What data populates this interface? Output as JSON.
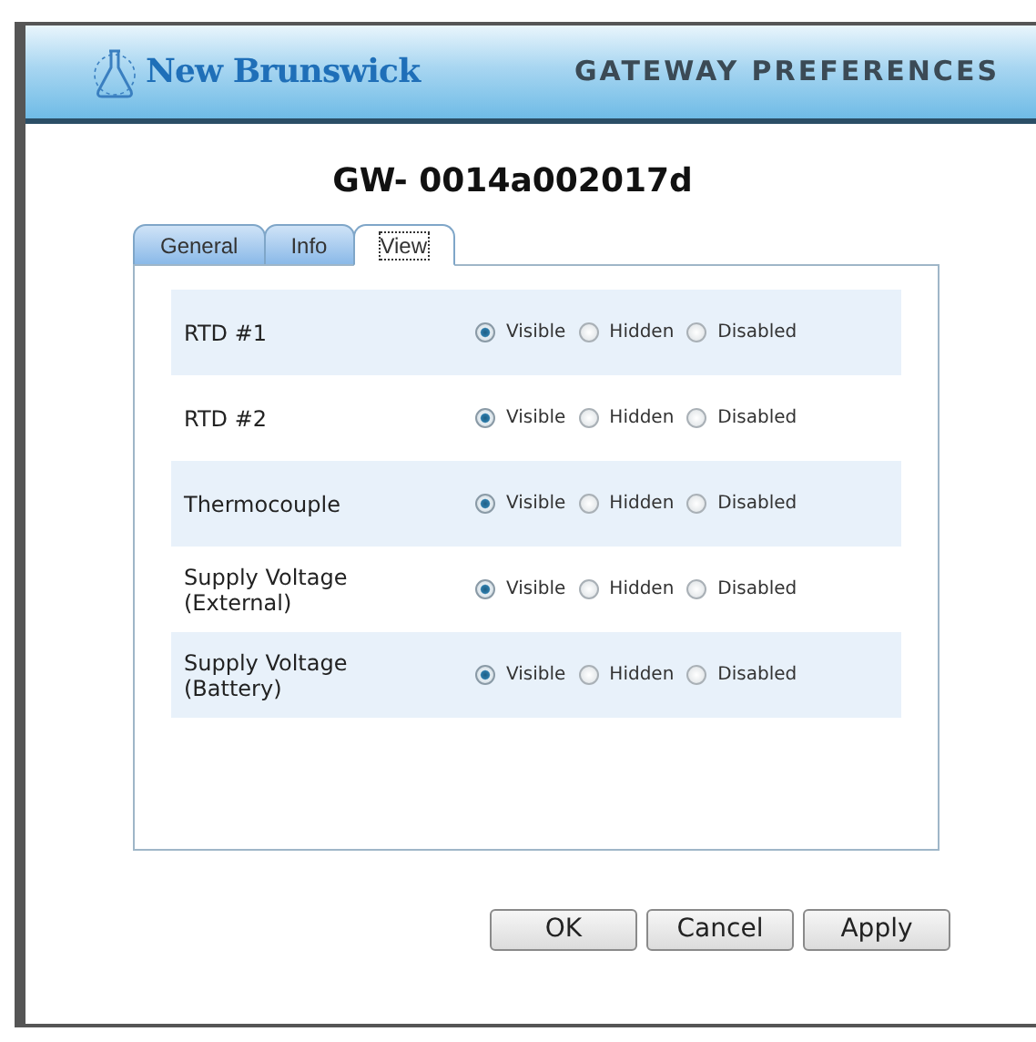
{
  "header": {
    "brand": "New Brunswick",
    "title": "GATEWAY PREFERENCES"
  },
  "device_title": "GW- 0014a002017d",
  "tabs": [
    {
      "label": "General",
      "selected": false
    },
    {
      "label": "Info",
      "selected": false
    },
    {
      "label": "View",
      "selected": true
    }
  ],
  "rows": [
    {
      "label": "RTD #1",
      "options": [
        {
          "label": "Visible",
          "selected": true
        },
        {
          "label": "Hidden",
          "selected": false
        },
        {
          "label": "Disabled",
          "selected": false
        }
      ]
    },
    {
      "label": "RTD #2",
      "options": [
        {
          "label": "Visible",
          "selected": true
        },
        {
          "label": "Hidden",
          "selected": false
        },
        {
          "label": "Disabled",
          "selected": false
        }
      ]
    },
    {
      "label": "Thermocouple",
      "options": [
        {
          "label": "Visible",
          "selected": true
        },
        {
          "label": "Hidden",
          "selected": false
        },
        {
          "label": "Disabled",
          "selected": false
        }
      ]
    },
    {
      "label": "Supply Voltage (External)",
      "options": [
        {
          "label": "Visible",
          "selected": true
        },
        {
          "label": "Hidden",
          "selected": false
        },
        {
          "label": "Disabled",
          "selected": false
        }
      ]
    },
    {
      "label": "Supply Voltage (Battery)",
      "options": [
        {
          "label": "Visible",
          "selected": true
        },
        {
          "label": "Hidden",
          "selected": false
        },
        {
          "label": "Disabled",
          "selected": false
        }
      ]
    }
  ],
  "buttons": [
    "OK",
    "Cancel",
    "Apply"
  ]
}
